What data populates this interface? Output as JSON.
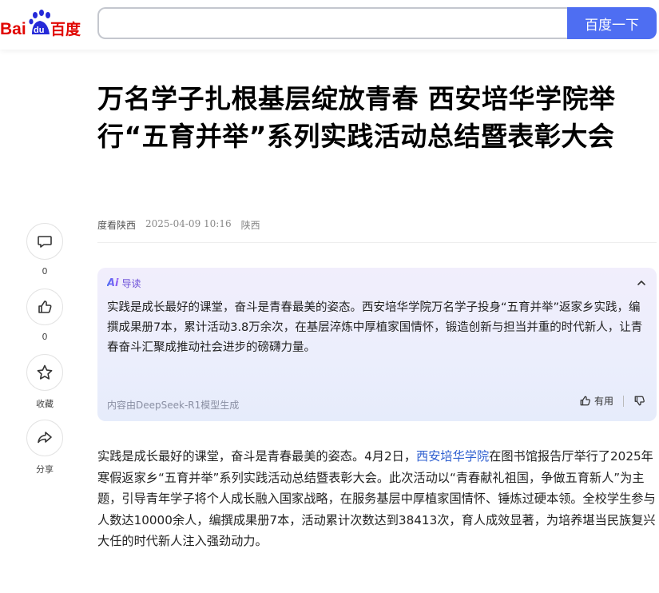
{
  "header": {
    "logo_text_left": "Bai",
    "logo_text_du": "du",
    "logo_text_right": "百度",
    "search_value": "",
    "search_button": "百度一下",
    "brand_color": "#4e6ef2"
  },
  "article": {
    "title": "万名学子扎根基层绽放青春 西安培华学院举行“五育并举”系列实践活动总结暨表彰大会",
    "source": "度看陕西",
    "date": "2025-04-09 10:16",
    "region": "陕西",
    "body_before_link": "实践是成长最好的课堂，奋斗是青春最美的姿态。4月2日，",
    "body_link": "西安培华学院",
    "body_after_link": "在图书馆报告厅举行了2025年寒假返家乡“五育并举”系列实践活动总结暨表彰大会。此次活动以“青春献礼祖国，争做五育新人”为主题，引导青年学子将个人成长融入国家战略，在服务基层中厚植家国情怀、锤炼过硬本领。全校学生参与人数达10000余人，编撰成果册7本，活动累计次数达到38413次，育人成效显著，为培养堪当民族复兴大任的时代新人注入强劲动力。"
  },
  "rail": {
    "comment_count": "0",
    "like_count": "0",
    "favorite_label": "收藏",
    "share_label": "分享"
  },
  "ai_panel": {
    "mark": "Ai",
    "heading": "导读",
    "summary": "实践是成长最好的课堂，奋斗是青春最美的姿态。西安培华学院万名学子投身“五育并举”返家乡实践，编撰成果册7本，累计活动3.8万余次，在基层淬炼中厚植家国情怀，锻造创新与担当并重的时代新人，让青春奋斗汇聚成推动社会进步的磅礴力量。",
    "footnote": "内容由DeepSeek-R1模型生成",
    "useful_label": "有用"
  }
}
